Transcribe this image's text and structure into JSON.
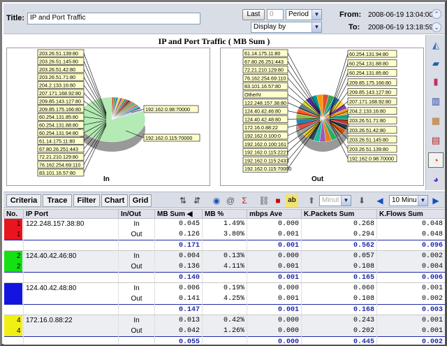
{
  "header": {
    "title_label": "Title:",
    "title_value": "IP and Port Traffic",
    "last_button": "Last",
    "count_value": "0",
    "period_select": "Period",
    "display_select": "Display by",
    "from_label": "From:",
    "from_value": "2008-06-19 13:04:00",
    "to_label": "To:",
    "to_value": "2008-06-19 13:18:59"
  },
  "chart": {
    "title": "IP and Port Traffic ( MB Sum )",
    "in_label": "In",
    "out_label": "Out"
  },
  "chart_data": [
    {
      "type": "pie",
      "title": "In",
      "labels": [
        "203.26.51.139:80",
        "203.26.51.145:80",
        "203.26.51.42:80",
        "203.26.51.71:80",
        "204.2.133.16:80",
        "207.171.168.92:80",
        "209.85.143.127:80",
        "209.85.175.166:80",
        "60.254.131.85:80",
        "60.254.131.88:80",
        "60.254.131.94:80",
        "61.14.175.11:80",
        "67.80.26.251:443",
        "72.21.210.129:80",
        "76.162.254.69:110",
        "83.101.16.57:80",
        "192.162.0.98:70000",
        "192.162.0.115:70000"
      ],
      "values": [
        1,
        1,
        1,
        1,
        1,
        1,
        1,
        1,
        1,
        1,
        1,
        1,
        1,
        1,
        1,
        1,
        2,
        78
      ]
    },
    {
      "type": "pie",
      "title": "Out",
      "labels": [
        "61.14.175.11:80",
        "67.80.26.251:443",
        "72.21.210.129:80",
        "76.162.254.69:110",
        "83.101.16.57:80",
        "OtherN",
        "122.248.157.38:80",
        "124.40.42.46:80",
        "124.40.42.48:80",
        "172.16.0.88:22",
        "192.162.0.100:0",
        "192.162.0.100:161",
        "192.162.0.115:2221",
        "192.162.0.115:2433",
        "192.162.0.115:70000",
        "60.254.131.94:80",
        "60.254.131.88:80",
        "60.254.131.85:80",
        "209.85.175.166:80",
        "209.85.143.127:80",
        "207.171.168.92:80",
        "204.2.133.16:80",
        "203.26.51.71:80",
        "203.26.51.42:80",
        "203.26.51.145:80",
        "203.26.51.139:80",
        "192.162.0.98:70000"
      ],
      "values": [
        4,
        4,
        4,
        4,
        4,
        4,
        4,
        4,
        4,
        4,
        4,
        4,
        4,
        4,
        4,
        4,
        4,
        4,
        4,
        4,
        4,
        4,
        4,
        4,
        4,
        4,
        4
      ]
    }
  ],
  "in_labels_left": [
    "203.26.51.139:80",
    "203.26.51.145:80",
    "203.26.51.42:80",
    "203.26.51.71:80",
    "204.2.133.16:80",
    "207.171.168.92:80",
    "209.85.143.127:80",
    "209.85.175.166:80",
    "60.254.131.85:80",
    "60.254.131.88:80",
    "60.254.131.94:80",
    "61.14.175.11:80",
    "67.80.26.251:443",
    "72.21.210.129:80",
    "76.162.254.69:110",
    "83.101.16.57:80"
  ],
  "in_labels_right": [
    "192.162.0.98:70000",
    "192.162.0.115:70000"
  ],
  "out_labels_left": [
    "61.14.175.11:80",
    "67.80.26.251:443",
    "72.21.210.129:80",
    "76.162.254.69:110",
    "83.101.16.57:80",
    "OtherN",
    "122.248.157.38:80",
    "124.40.42.46:80",
    "124.40.42.48:80",
    "172.16.0.88:22",
    "192.162.0.100:0",
    "192.162.0.100:161",
    "192.162.0.115:2221",
    "192.162.0.115:2433",
    "192.162.0.115:70000"
  ],
  "out_labels_right": [
    "60.254.131.94:80",
    "60.254.131.88:80",
    "60.254.131.85:80",
    "209.85.175.166:80",
    "209.85.143.127:80",
    "207.171.168.92:80",
    "204.2.133.16:80",
    "203.26.51.71:80",
    "203.26.51.42:80",
    "203.26.51.145:80",
    "203.26.51.139:80",
    "192.162.0.98:70000"
  ],
  "tabs": [
    "Criteria",
    "Trace",
    "Filter",
    "Chart",
    "Grid"
  ],
  "toolbar": {
    "minute_select": "Minut",
    "interval_select": "10 Minu"
  },
  "grid": {
    "columns": [
      "No.",
      "IP Port",
      "In/Out",
      "MB Sum",
      "MB %",
      "mbps Ave",
      "K.Packets Sum",
      "K.Flows Sum"
    ],
    "groups": [
      {
        "no": "1",
        "color": "#e8141e",
        "ip": "122.248.157.38:80",
        "rows": [
          [
            "In",
            "0.045",
            "1.49%",
            "0.000",
            "0.268",
            "0.048"
          ],
          [
            "Out",
            "0.126",
            "3.80%",
            "0.001",
            "0.294",
            "0.048"
          ]
        ],
        "sum": [
          "0.171",
          "",
          "0.001",
          "0.562",
          "0.096"
        ]
      },
      {
        "no": "2",
        "color": "#14e014",
        "ip": "124.40.42.46:80",
        "rows": [
          [
            "In",
            "0.004",
            "0.13%",
            "0.000",
            "0.057",
            "0.002"
          ],
          [
            "Out",
            "0.136",
            "4.11%",
            "0.001",
            "0.108",
            "0.004"
          ]
        ],
        "sum": [
          "0.140",
          "",
          "0.001",
          "0.165",
          "0.006"
        ]
      },
      {
        "no": "3",
        "color": "#1414e0",
        "ip": "124.40.42.48:80",
        "rows": [
          [
            "In",
            "0.006",
            "0.19%",
            "0.000",
            "0.060",
            "0.001"
          ],
          [
            "Out",
            "0.141",
            "4.25%",
            "0.001",
            "0.108",
            "0.002"
          ]
        ],
        "sum": [
          "0.147",
          "",
          "0.001",
          "0.168",
          "0.003"
        ]
      },
      {
        "no": "4",
        "color": "#f0f014",
        "ip": "172.16.0.88:22",
        "rows": [
          [
            "In",
            "0.013",
            "0.42%",
            "0.000",
            "0.243",
            "0.001"
          ],
          [
            "Out",
            "0.042",
            "1.26%",
            "0.000",
            "0.202",
            "0.001"
          ]
        ],
        "sum": [
          "0.055",
          "",
          "0.000",
          "0.445",
          "0.002"
        ]
      }
    ]
  }
}
